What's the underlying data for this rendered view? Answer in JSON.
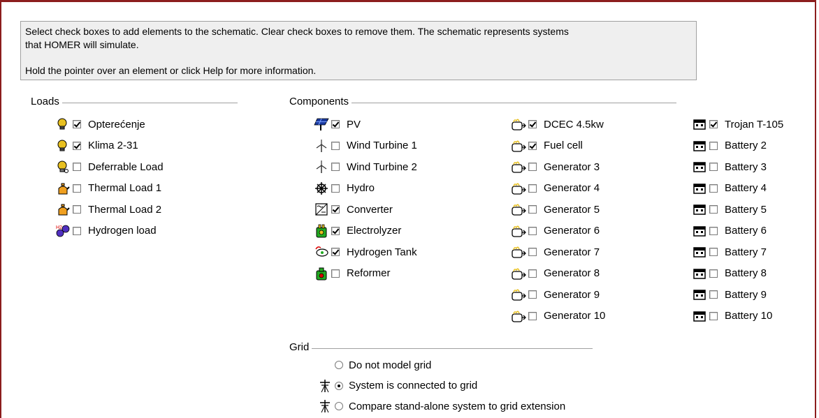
{
  "info": {
    "line1": "Select check boxes to add elements to the schematic. Clear check boxes to remove them. The schematic represents systems",
    "line2": "that HOMER will simulate.",
    "line3": "Hold the pointer over an element or click Help for more information."
  },
  "loads": {
    "title": "Loads",
    "items": [
      {
        "label": "Opterećenje",
        "checked": true,
        "icon": "bulb-icon"
      },
      {
        "label": "Klima 2-31",
        "checked": true,
        "icon": "bulb-icon"
      },
      {
        "label": "Deferrable Load",
        "checked": false,
        "icon": "deferrable-bulb-icon"
      },
      {
        "label": "Thermal Load 1",
        "checked": false,
        "icon": "kettle-icon"
      },
      {
        "label": "Thermal Load 2",
        "checked": false,
        "icon": "kettle-icon"
      },
      {
        "label": "Hydrogen load",
        "checked": false,
        "icon": "hydrogen-molecule-icon"
      }
    ]
  },
  "components": {
    "title": "Components",
    "items": [
      {
        "label": "PV",
        "checked": true,
        "icon": "solar-panel-icon"
      },
      {
        "label": "Wind Turbine 1",
        "checked": false,
        "icon": "wind-turbine-icon"
      },
      {
        "label": "Wind Turbine 2",
        "checked": false,
        "icon": "wind-turbine-icon"
      },
      {
        "label": "Hydro",
        "checked": false,
        "icon": "hydro-wheel-icon"
      },
      {
        "label": "Converter",
        "checked": true,
        "icon": "converter-icon"
      },
      {
        "label": "Electrolyzer",
        "checked": true,
        "icon": "electrolyzer-icon"
      },
      {
        "label": "Hydrogen Tank",
        "checked": true,
        "icon": "hydrogen-tank-icon"
      },
      {
        "label": "Reformer",
        "checked": false,
        "icon": "reformer-icon"
      }
    ],
    "generators": [
      {
        "label": "DCEC 4.5kw",
        "checked": true
      },
      {
        "label": "Fuel cell",
        "checked": true
      },
      {
        "label": "Generator 3",
        "checked": false
      },
      {
        "label": "Generator 4",
        "checked": false
      },
      {
        "label": "Generator 5",
        "checked": false
      },
      {
        "label": "Generator 6",
        "checked": false
      },
      {
        "label": "Generator 7",
        "checked": false
      },
      {
        "label": "Generator 8",
        "checked": false
      },
      {
        "label": "Generator 9",
        "checked": false
      },
      {
        "label": "Generator 10",
        "checked": false
      }
    ],
    "batteries": [
      {
        "label": "Trojan T-105",
        "checked": true
      },
      {
        "label": "Battery 2",
        "checked": false
      },
      {
        "label": "Battery 3",
        "checked": false
      },
      {
        "label": "Battery 4",
        "checked": false
      },
      {
        "label": "Battery 5",
        "checked": false
      },
      {
        "label": "Battery 6",
        "checked": false
      },
      {
        "label": "Battery 7",
        "checked": false
      },
      {
        "label": "Battery 8",
        "checked": false
      },
      {
        "label": "Battery 9",
        "checked": false
      },
      {
        "label": "Battery 10",
        "checked": false
      }
    ]
  },
  "grid": {
    "title": "Grid",
    "options": [
      {
        "label": "Do not model grid",
        "selected": false,
        "icon": ""
      },
      {
        "label": "System is connected to grid",
        "selected": true,
        "icon": "transmission-tower-icon"
      },
      {
        "label": "Compare stand-alone system to grid extension",
        "selected": false,
        "icon": "transmission-tower-icon"
      }
    ]
  },
  "colors": {
    "frame": "#8c1d1d",
    "panel_bg": "#efefef",
    "bulb": "#e0b000",
    "solar": "#1a3aa0",
    "electrolyzer": "#22aa22"
  }
}
